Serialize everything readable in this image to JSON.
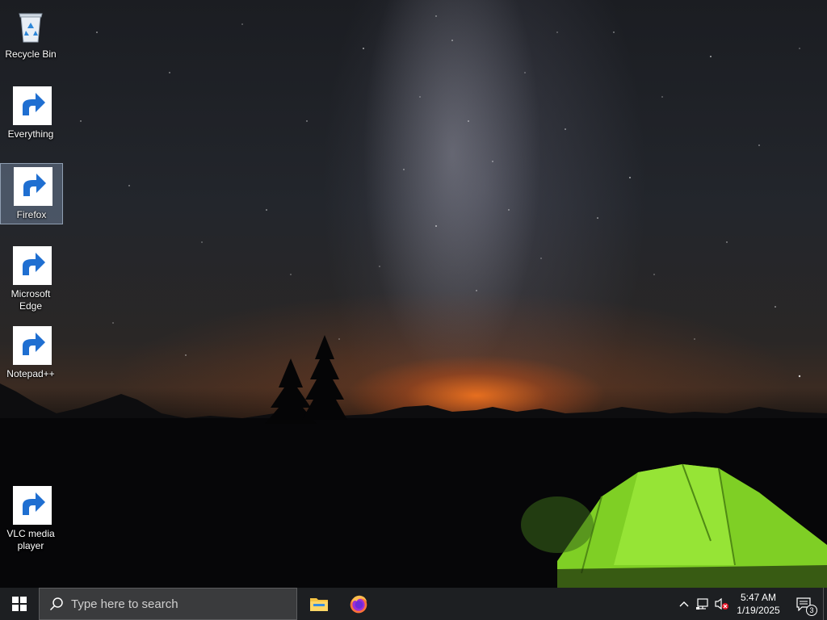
{
  "desktop": {
    "icons": [
      {
        "label": "Recycle Bin",
        "icon": "recycle-bin-icon",
        "shortcut": false,
        "selected": false
      },
      {
        "label": "Everything",
        "icon": "everything-search-icon",
        "shortcut": true,
        "selected": false
      },
      {
        "label": "Firefox",
        "icon": "firefox-icon",
        "shortcut": true,
        "selected": true
      },
      {
        "label": "Microsoft Edge",
        "icon": "edge-icon",
        "shortcut": true,
        "selected": false
      },
      {
        "label": "Notepad++",
        "icon": "notepad-plus-plus-icon",
        "shortcut": true,
        "selected": false
      },
      {
        "label": "VLC media player",
        "icon": "vlc-icon",
        "shortcut": true,
        "selected": false
      }
    ]
  },
  "taskbar": {
    "search_placeholder": "Type here to search",
    "pinned_apps": [
      {
        "name": "File Explorer",
        "icon": "file-explorer-icon"
      },
      {
        "name": "Firefox",
        "icon": "firefox-icon"
      }
    ],
    "tray": {
      "chevron_icon": "chevron-up-icon",
      "network_icon": "network-icon",
      "volume_icon": "volume-muted-icon"
    },
    "clock": {
      "time": "5:47 AM",
      "date": "1/19/2025"
    },
    "notifications": {
      "count": "3"
    }
  },
  "colors": {
    "taskbar_bg": "#1d1f22",
    "search_bg": "#3a3b3d",
    "selection": "#96afd2",
    "firefox_orange": "#ff7139",
    "edge_blue": "#0c59a4",
    "tent_green": "#8ee02a"
  }
}
